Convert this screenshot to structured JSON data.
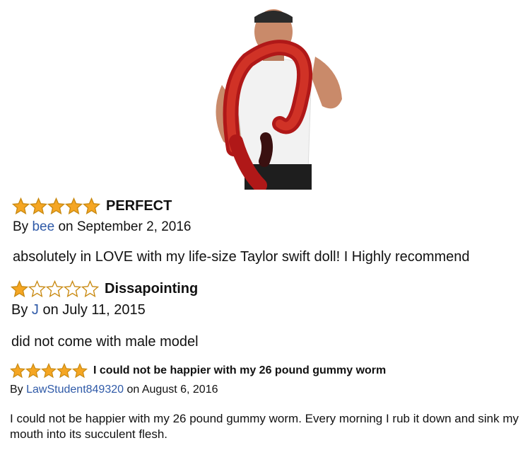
{
  "colors": {
    "star_fill": "#f5a623",
    "star_stroke": "#c98a12",
    "author_link": "#2f5aa8"
  },
  "reviews": [
    {
      "rating": 5,
      "title": "PERFECT",
      "by": "By",
      "author": "bee",
      "date": "on September 2, 2016",
      "body": "absolutely in LOVE with my life-size Taylor swift doll! I Highly recommend"
    },
    {
      "rating": 1,
      "title": "Dissapointing",
      "by": "By",
      "author": "J",
      "date": "on July 11, 2015",
      "body": "did not come with male model"
    },
    {
      "rating": 5,
      "title": "I could not be happier with my 26 pound gummy worm",
      "by": "By",
      "author": "LawStudent849320",
      "date": "on August 6, 2016",
      "body": "I could not be happier with my 26 pound gummy worm. Every morning I rub it down and sink my mouth into its succulent flesh."
    }
  ]
}
